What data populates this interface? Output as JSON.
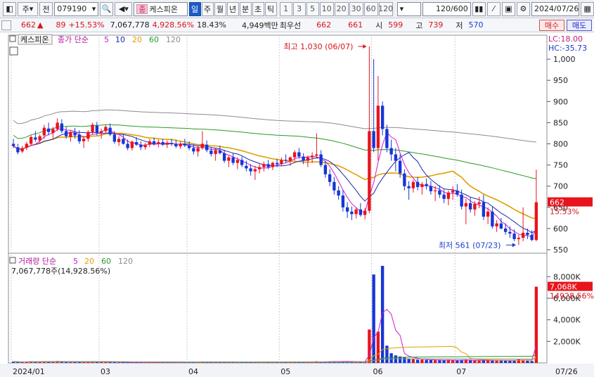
{
  "toolbar": {
    "market": "주",
    "prefix": "전",
    "code": "079190",
    "stock_name_tag": "종",
    "stock_name": "케스피온",
    "periods": [
      "일",
      "주",
      "월",
      "년",
      "분",
      "초",
      "틱"
    ],
    "intervals": [
      "1",
      "3",
      "5",
      "10",
      "20",
      "30",
      "60",
      "120"
    ],
    "count": "120",
    "count_total": "/600",
    "date": "2024/07/26"
  },
  "info": {
    "price": "662",
    "change": "89",
    "change_pct": "+15.53%",
    "volume": "7,067,778",
    "volume_ratio": "4,928.56%",
    "turnover": "18.43%",
    "amount": "4,949백만",
    "priority_label": "최우선",
    "bid": "662",
    "ask": "661",
    "open_label": "시",
    "open": "599",
    "high_label": "고",
    "high": "739",
    "low_label": "저",
    "low": "570",
    "buy_label": "매수",
    "sell_label": "매도"
  },
  "price_panel": {
    "stock_tag": "케스피온",
    "ma_label": "종가 단순",
    "ma_periods": [
      "5",
      "10",
      "20",
      "60",
      "120"
    ],
    "lc": "LC:18.00",
    "hc": "HC:-35.73",
    "high_note": "최고 1,030 (06/07)",
    "low_note": "최저 561 (07/23)",
    "current_price": "662",
    "current_pct": "15.53%"
  },
  "volume_panel": {
    "label": "거래량 단순",
    "ma_periods": [
      "5",
      "20",
      "60",
      "120"
    ],
    "summary": "7,067,778주(14,928.56%)",
    "current_vol": "7,068K",
    "current_pct": "14928.56%"
  },
  "colors": {
    "up": "#e8141c",
    "down": "#1536d8",
    "ma5": "#d01ad0",
    "ma10": "#1a2aa8",
    "ma20": "#e0a000",
    "ma60": "#2a9a2a",
    "ma120": "#8c8c8c"
  },
  "chart_data": {
    "type": "candlestick",
    "price_axis": {
      "min": 545,
      "max": 1040,
      "ticks": [
        550,
        600,
        650,
        700,
        750,
        800,
        850,
        900,
        950,
        1000
      ]
    },
    "volume_axis": {
      "min": 0,
      "max": 9000,
      "ticks": [
        2000,
        4000,
        6000,
        8000
      ],
      "tick_labels": [
        "2,000K",
        "4,000K",
        "6,000K",
        "8,000K"
      ]
    },
    "x_labels": [
      {
        "i": 0,
        "label": "2024/01"
      },
      {
        "i": 20,
        "label": "03"
      },
      {
        "i": 40,
        "label": "04"
      },
      {
        "i": 61,
        "label": "05"
      },
      {
        "i": 82,
        "label": "06"
      },
      {
        "i": 101,
        "label": "07"
      },
      {
        "i": 119,
        "label": "07/26"
      }
    ],
    "ohlc": [
      [
        800,
        812,
        790,
        795
      ],
      [
        792,
        800,
        775,
        780
      ],
      [
        782,
        795,
        778,
        790
      ],
      [
        791,
        805,
        785,
        800
      ],
      [
        800,
        820,
        796,
        816
      ],
      [
        815,
        830,
        805,
        810
      ],
      [
        808,
        822,
        800,
        818
      ],
      [
        820,
        845,
        812,
        838
      ],
      [
        836,
        850,
        820,
        828
      ],
      [
        826,
        840,
        810,
        835
      ],
      [
        835,
        860,
        830,
        850
      ],
      [
        848,
        858,
        825,
        830
      ],
      [
        830,
        840,
        812,
        818
      ],
      [
        816,
        832,
        805,
        828
      ],
      [
        826,
        838,
        812,
        820
      ],
      [
        822,
        832,
        800,
        806
      ],
      [
        806,
        818,
        790,
        812
      ],
      [
        812,
        832,
        805,
        828
      ],
      [
        828,
        850,
        822,
        845
      ],
      [
        843,
        852,
        820,
        826
      ],
      [
        826,
        836,
        812,
        830
      ],
      [
        830,
        845,
        825,
        840
      ],
      [
        838,
        848,
        818,
        822
      ],
      [
        822,
        830,
        800,
        805
      ],
      [
        804,
        818,
        795,
        812
      ],
      [
        812,
        822,
        798,
        800
      ],
      [
        800,
        810,
        785,
        790
      ],
      [
        790,
        808,
        784,
        805
      ],
      [
        804,
        816,
        795,
        798
      ],
      [
        798,
        806,
        785,
        792
      ],
      [
        792,
        802,
        786,
        798
      ],
      [
        798,
        812,
        792,
        806
      ],
      [
        806,
        815,
        796,
        800
      ],
      [
        800,
        810,
        792,
        804
      ],
      [
        804,
        812,
        795,
        798
      ],
      [
        798,
        808,
        790,
        802
      ],
      [
        802,
        812,
        795,
        800
      ],
      [
        800,
        810,
        790,
        794
      ],
      [
        794,
        806,
        788,
        800
      ],
      [
        800,
        812,
        792,
        796
      ],
      [
        796,
        806,
        785,
        790
      ],
      [
        790,
        800,
        775,
        782
      ],
      [
        782,
        795,
        770,
        790
      ],
      [
        790,
        830,
        786,
        800
      ],
      [
        798,
        808,
        780,
        785
      ],
      [
        784,
        792,
        770,
        776
      ],
      [
        776,
        790,
        760,
        785
      ],
      [
        784,
        796,
        775,
        778
      ],
      [
        778,
        786,
        755,
        760
      ],
      [
        760,
        772,
        745,
        768
      ],
      [
        768,
        778,
        750,
        755
      ],
      [
        755,
        768,
        740,
        762
      ],
      [
        762,
        770,
        745,
        750
      ],
      [
        748,
        760,
        735,
        742
      ],
      [
        742,
        752,
        725,
        735
      ],
      [
        735,
        748,
        715,
        740
      ],
      [
        740,
        752,
        730,
        745
      ],
      [
        745,
        758,
        735,
        752
      ],
      [
        752,
        762,
        740,
        745
      ],
      [
        745,
        758,
        738,
        755
      ],
      [
        755,
        765,
        745,
        752
      ],
      [
        752,
        768,
        748,
        762
      ],
      [
        762,
        775,
        755,
        760
      ],
      [
        760,
        770,
        748,
        768
      ],
      [
        768,
        785,
        760,
        780
      ],
      [
        780,
        790,
        765,
        770
      ],
      [
        770,
        778,
        752,
        760
      ],
      [
        760,
        772,
        745,
        768
      ],
      [
        768,
        780,
        755,
        772
      ],
      [
        772,
        825,
        765,
        775
      ],
      [
        775,
        785,
        745,
        750
      ],
      [
        750,
        760,
        720,
        728
      ],
      [
        728,
        740,
        700,
        710
      ],
      [
        710,
        722,
        680,
        690
      ],
      [
        690,
        700,
        668,
        678
      ],
      [
        678,
        690,
        640,
        650
      ],
      [
        650,
        662,
        625,
        640
      ],
      [
        640,
        652,
        620,
        634
      ],
      [
        634,
        650,
        624,
        645
      ],
      [
        645,
        660,
        628,
        632
      ],
      [
        632,
        648,
        622,
        642
      ],
      [
        642,
        1030,
        636,
        830
      ],
      [
        830,
        1000,
        780,
        790
      ],
      [
        790,
        960,
        760,
        890
      ],
      [
        890,
        900,
        820,
        835
      ],
      [
        835,
        845,
        780,
        790
      ],
      [
        790,
        810,
        760,
        775
      ],
      [
        775,
        790,
        735,
        760
      ],
      [
        760,
        775,
        720,
        730
      ],
      [
        730,
        740,
        690,
        700
      ],
      [
        700,
        712,
        668,
        695
      ],
      [
        695,
        715,
        685,
        710
      ],
      [
        710,
        722,
        690,
        698
      ],
      [
        698,
        710,
        680,
        705
      ],
      [
        705,
        718,
        692,
        700
      ],
      [
        700,
        712,
        680,
        688
      ],
      [
        688,
        700,
        665,
        690
      ],
      [
        690,
        702,
        672,
        680
      ],
      [
        680,
        692,
        660,
        670
      ],
      [
        670,
        690,
        655,
        685
      ],
      [
        685,
        700,
        668,
        690
      ],
      [
        690,
        705,
        675,
        680
      ],
      [
        680,
        692,
        645,
        652
      ],
      [
        652,
        670,
        610,
        660
      ],
      [
        660,
        675,
        638,
        645
      ],
      [
        645,
        665,
        630,
        658
      ],
      [
        658,
        675,
        648,
        662
      ],
      [
        662,
        680,
        620,
        628
      ],
      [
        628,
        650,
        610,
        640
      ],
      [
        640,
        652,
        600,
        605
      ],
      [
        605,
        620,
        592,
        612
      ],
      [
        612,
        625,
        598,
        600
      ],
      [
        600,
        612,
        585,
        592
      ],
      [
        592,
        605,
        578,
        588
      ],
      [
        588,
        598,
        570,
        575
      ],
      [
        575,
        585,
        561,
        578
      ],
      [
        578,
        650,
        570,
        590
      ],
      [
        590,
        600,
        575,
        585
      ],
      [
        585,
        596,
        570,
        573
      ],
      [
        573,
        739,
        570,
        662
      ]
    ],
    "volume": [
      120,
      90,
      80,
      100,
      140,
      110,
      90,
      160,
      130,
      100,
      180,
      120,
      90,
      100,
      80,
      90,
      70,
      110,
      150,
      100,
      90,
      110,
      80,
      70,
      60,
      70,
      60,
      80,
      60,
      50,
      60,
      70,
      60,
      50,
      60,
      50,
      60,
      50,
      60,
      50,
      60,
      80,
      70,
      130,
      90,
      80,
      110,
      70,
      80,
      60,
      70,
      60,
      60,
      70,
      80,
      90,
      60,
      70,
      60,
      70,
      80,
      90,
      70,
      80,
      110,
      90,
      70,
      80,
      70,
      150,
      100,
      120,
      140,
      150,
      110,
      160,
      130,
      120,
      110,
      100,
      110,
      3100,
      8200,
      2900,
      9000,
      1600,
      900,
      700,
      600,
      550,
      400,
      350,
      300,
      320,
      280,
      260,
      250,
      240,
      230,
      300,
      260,
      220,
      260,
      300,
      240,
      220,
      210,
      280,
      250,
      220,
      200,
      210,
      230,
      200,
      260,
      380,
      250,
      200,
      180,
      7068
    ],
    "ma5_vol_note": "derived"
  }
}
